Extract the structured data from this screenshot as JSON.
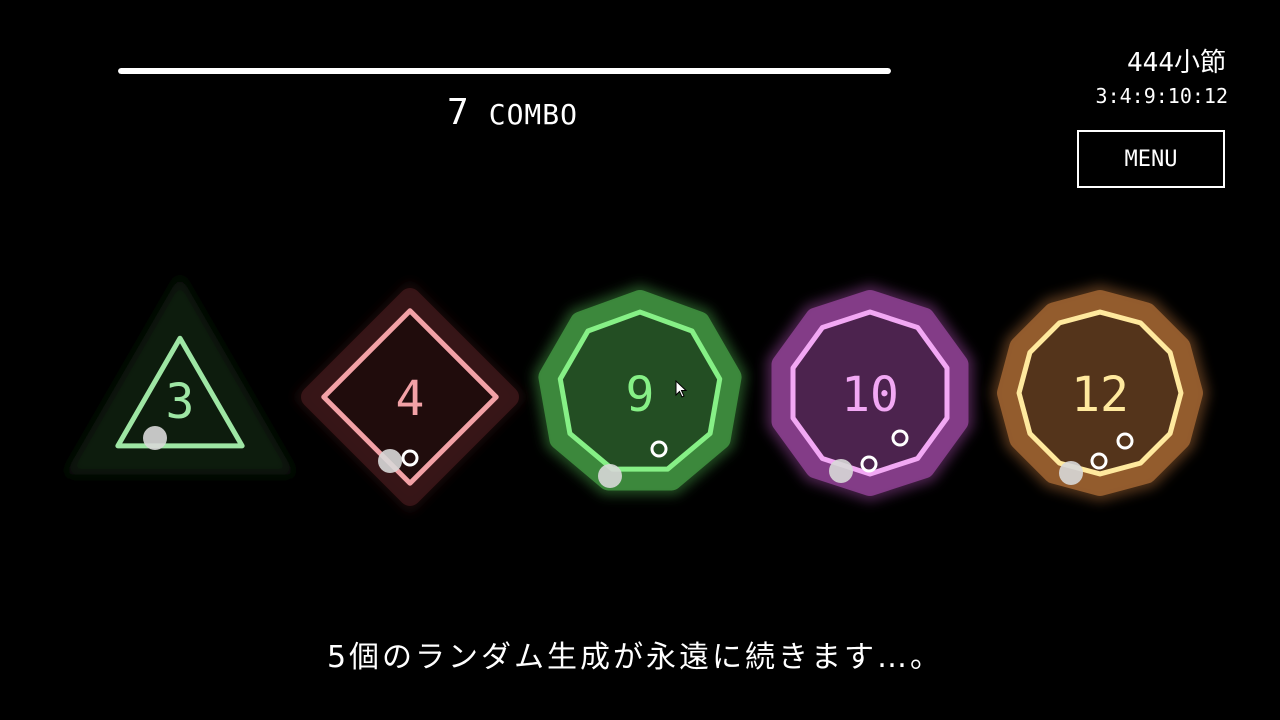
{
  "progress": {
    "fraction": 1.0
  },
  "combo": {
    "count": "7",
    "label": "COMBO"
  },
  "measure": {
    "text": "444小節"
  },
  "sequence": {
    "text": "3:4:9:10:12"
  },
  "menu": {
    "label": "MENU"
  },
  "subtitle": {
    "text": "5個のランダム生成が永遠に続きます…。"
  },
  "polygons": [
    {
      "sides": 3,
      "label": "3",
      "color": "#9ee6a4",
      "glow": "#0c1a0c",
      "dots": 0
    },
    {
      "sides": 4,
      "label": "4",
      "color": "#f2a1a6",
      "glow": "#3a1618",
      "dots": 1
    },
    {
      "sides": 9,
      "label": "9",
      "color": "#86f086",
      "glow": "#3f8f3f",
      "dots": 1
    },
    {
      "sides": 10,
      "label": "10",
      "color": "#f2a8f4",
      "glow": "#8a3f8e",
      "dots": 2
    },
    {
      "sides": 12,
      "label": "12",
      "color": "#ffe99e",
      "glow": "#9a6030",
      "dots": 2
    }
  ]
}
